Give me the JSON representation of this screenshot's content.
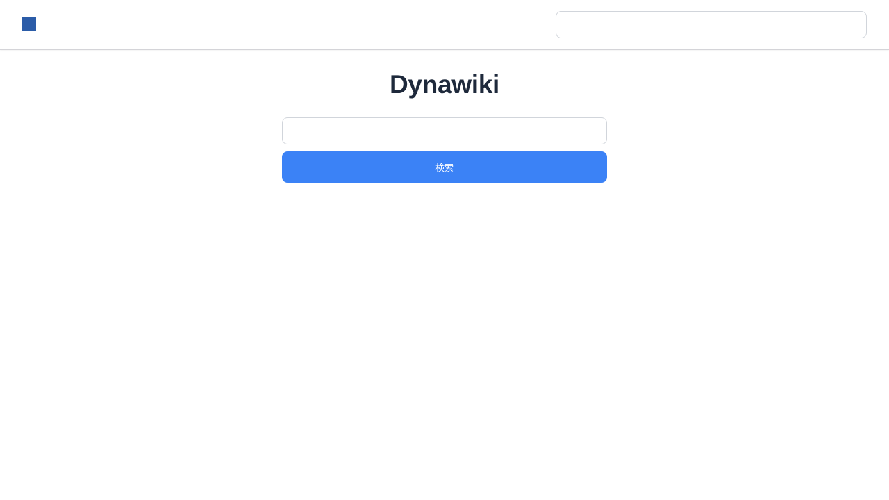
{
  "colors": {
    "logo": "#2b5ca8",
    "accent": "#3b82f6",
    "title_text": "#1e293b"
  },
  "header": {
    "logo_icon": "square-logo-icon",
    "search": {
      "value": "",
      "placeholder": ""
    }
  },
  "main": {
    "title": "Dynawiki",
    "search": {
      "value": "",
      "placeholder": ""
    },
    "search_button_label": "検索"
  }
}
